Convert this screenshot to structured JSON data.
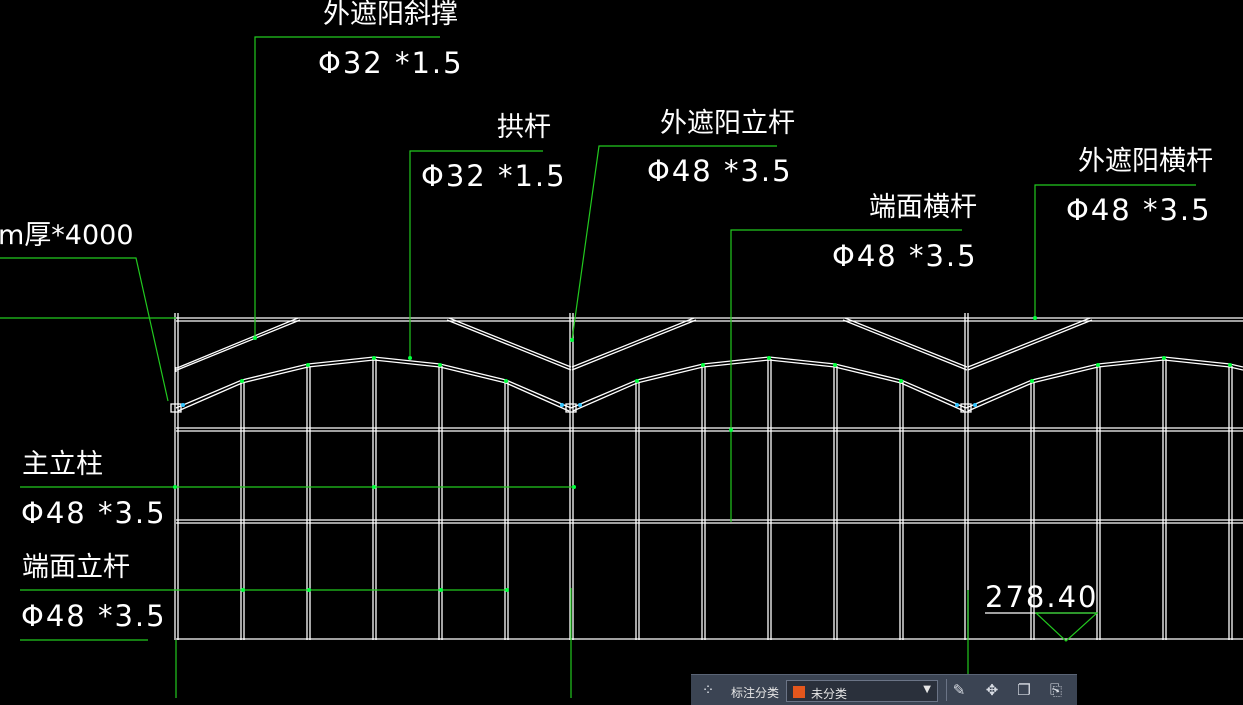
{
  "labels": {
    "diag_brace": {
      "name": "外遮阳斜撑",
      "spec": "Φ32 *1.5"
    },
    "arch_bar": {
      "name": "拱杆",
      "spec": "Φ32 *1.5"
    },
    "sunshade_post": {
      "name": "外遮阳立杆",
      "spec": "Φ48 *3.5"
    },
    "sunshade_beam": {
      "name": "外遮阳横杆",
      "spec": "Φ48 *3.5"
    },
    "end_beam": {
      "name": "端面横杆",
      "spec": "Φ48 *3.5"
    },
    "plate_partial": {
      "name": "m厚*4000"
    },
    "main_column": {
      "name": "主立柱",
      "spec": "Φ48 *3.5"
    },
    "end_post": {
      "name": "端面立杆",
      "spec": "Φ48 *3.5"
    }
  },
  "elevation": {
    "value": "278.40"
  },
  "toolbar": {
    "category_label": "标注分类",
    "category_value": "未分类",
    "category_color": "#e4571d",
    "icons": [
      "group-icon",
      "edit-icon",
      "move-icon",
      "copy-icon",
      "paste-icon"
    ]
  },
  "colors": {
    "background": "#000000",
    "structure": "#ffffff",
    "leader": "#22c91f",
    "node": "#00ff3c",
    "joint": "#33c5ff"
  }
}
